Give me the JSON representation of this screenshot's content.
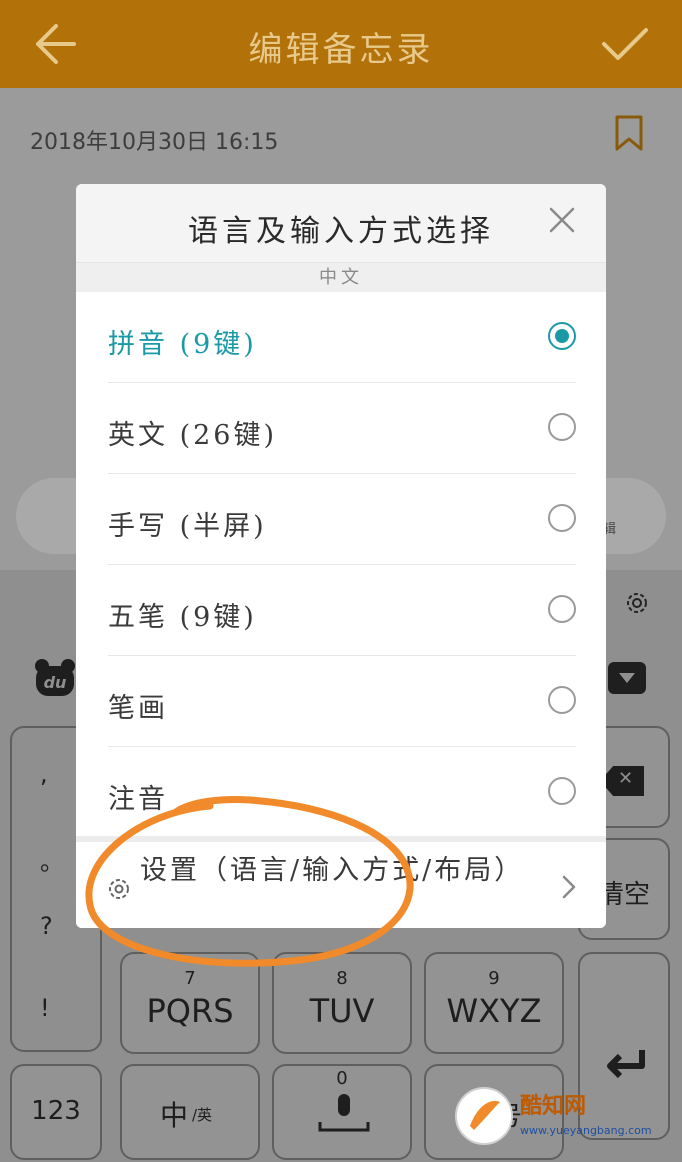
{
  "header": {
    "title": "编辑备忘录"
  },
  "memo": {
    "date": "2018年10月30日  16:15",
    "toolbar_edit_text": "辑"
  },
  "keyboard": {
    "symbols": [
      ",",
      "。",
      "?",
      "!"
    ],
    "keys": {
      "pqrs": {
        "num": "7",
        "letters": "PQRS"
      },
      "tuv": {
        "num": "8",
        "letters": "TUV"
      },
      "wxyz": {
        "num": "9",
        "letters": "WXYZ"
      },
      "zero": {
        "num": "0"
      }
    },
    "clear_label": "清空",
    "num_label": "123",
    "lang_label_main": "中",
    "lang_label_sub": "/英",
    "space_partial": "符号"
  },
  "dialog": {
    "title": "语言及输入方式选择",
    "section": "中文",
    "options": [
      {
        "label": "拼音 (9键)",
        "selected": true
      },
      {
        "label": "英文 (26键)",
        "selected": false
      },
      {
        "label": "手写 (半屏)",
        "selected": false
      },
      {
        "label": "五笔 (9键)",
        "selected": false
      },
      {
        "label": "笔画",
        "selected": false
      },
      {
        "label": "注音",
        "selected": false
      }
    ],
    "settings_label": "设置（语言/输入方式/布局）"
  },
  "watermark": {
    "title": "酷知网",
    "sub": "www.yueyangbang.com"
  },
  "colors": {
    "header": "#b37209",
    "accent": "#1a9aa6",
    "annotation": "#f08a2a"
  }
}
